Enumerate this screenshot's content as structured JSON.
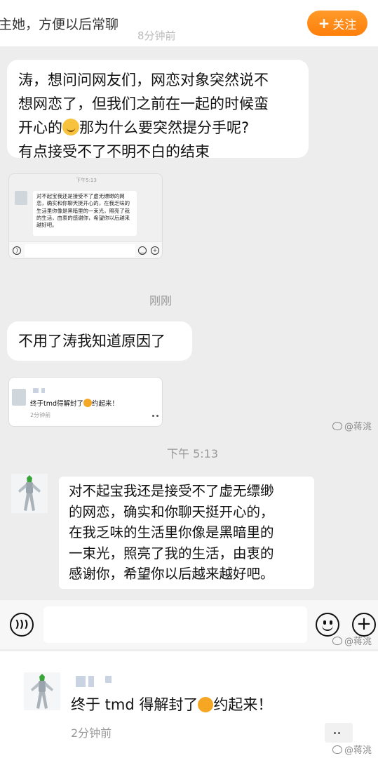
{
  "header": {
    "top_text": "主她，方便以后常聊",
    "faded_time": "8分钟前",
    "follow_label": "关注",
    "follow_plus": "+"
  },
  "messages": {
    "received_1": {
      "line1": "涛，想问问网友们，网恋对象突然说不",
      "line2": "想网恋了，但我们之前在一起的时候蛮",
      "line3a": "开心的",
      "line3b": "那为什么要突然提分手呢?",
      "line4": "有点接受不了不明不白的结束"
    },
    "screenshot_1": {
      "time": "下午5:13",
      "text": "对不起宝我还是接受不了虚无缥缈的网恋，确实和你聊天挺开心的，在我乏味的生活里你像是黑暗里的一束光，照亮了我的生活，由衷的感谢你，希望你以后越来越好吧。"
    },
    "time_just_now": "刚刚",
    "received_2": "不用了涛我知道原因了",
    "screenshot_2": {
      "text_a": "终于tmd得解封了",
      "text_b": "约起来！",
      "time": "2分钟前"
    },
    "time_label": "下午 5:13",
    "sent": {
      "line1": "对不起宝我还是接受不了虚无缥缈",
      "line2": "的网恋，确实和你聊天挺开心的，",
      "line3": "在我乏味的生活里你像是黑暗里的",
      "line4": "一束光，照亮了我的生活，由衷的",
      "line5": "感谢你，希望你以后越来越好吧。"
    }
  },
  "input_bar": {
    "voice_icon": "voice-icon",
    "emoji_icon": "emoji-icon",
    "plus_icon": "plus-icon"
  },
  "post": {
    "text_a": "终于 tmd 得解封了",
    "text_b": "约起来！",
    "time": "2分钟前"
  },
  "watermark": "@蒋洮",
  "colors": {
    "background": "#ededed",
    "bubble": "#ffffff",
    "accent": "#ff8c1a"
  }
}
